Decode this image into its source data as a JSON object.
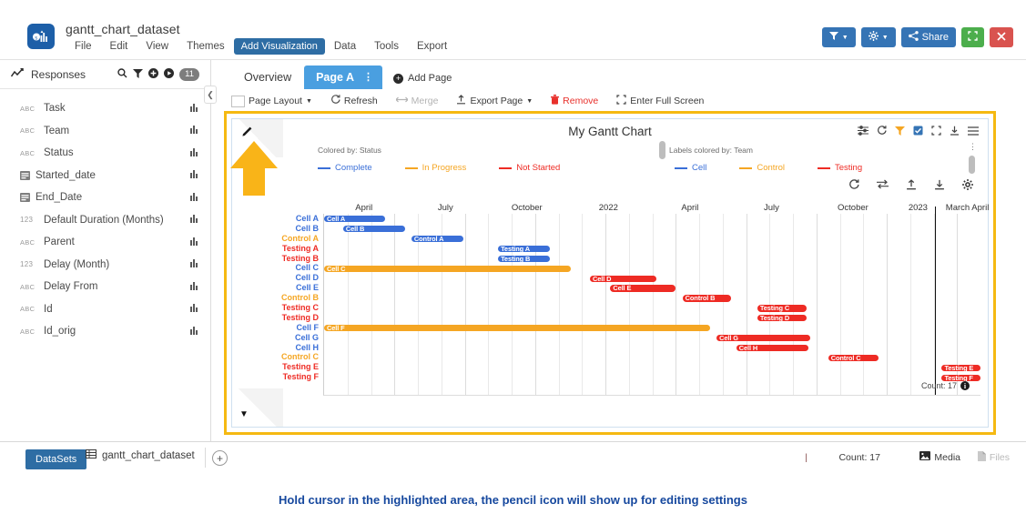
{
  "app": {
    "title": "gantt_chart_dataset",
    "logo_icon": "app-logo-icon",
    "menu": [
      "File",
      "Edit",
      "View",
      "Themes",
      "Add Visualization",
      "Data",
      "Tools",
      "Export"
    ],
    "active_menu": "Add Visualization"
  },
  "topright": {
    "filter_label": "",
    "filter_icon": "filter-icon",
    "settings_icon": "gear-icon",
    "share_label": "Share",
    "share_icon": "share-icon",
    "fullscreen_icon": "expand-icon",
    "close_icon": "close-icon",
    "colors": {
      "blue": "#3574b5",
      "green": "#4cae4c",
      "red": "#d9534f"
    }
  },
  "sidebar": {
    "header": {
      "label": "Responses",
      "icon": "chart-line-icon",
      "count": "11"
    },
    "header_icons": [
      "search-icon",
      "filter-icon",
      "add-circle-icon",
      "play-circle-icon"
    ],
    "fields": [
      {
        "type": "ABC",
        "name": "Task"
      },
      {
        "type": "ABC",
        "name": "Team"
      },
      {
        "type": "ABC",
        "name": "Status"
      },
      {
        "type": "DATE",
        "name": "Started_date"
      },
      {
        "type": "DATE",
        "name": "End_Date"
      },
      {
        "type": "123",
        "name": "Default Duration (Months)"
      },
      {
        "type": "ABC",
        "name": "Parent"
      },
      {
        "type": "123",
        "name": "Delay (Month)"
      },
      {
        "type": "ABC",
        "name": "Delay From"
      },
      {
        "type": "ABC",
        "name": "Id"
      },
      {
        "type": "ABC",
        "name": "Id_orig"
      }
    ],
    "collapse_icon": "chevron-left-icon"
  },
  "tabs": {
    "items": [
      {
        "label": "Overview",
        "active": false
      },
      {
        "label": "Page A",
        "active": true
      }
    ],
    "add_page_label": "Add Page"
  },
  "page_toolbar": [
    {
      "label": "Page Layout",
      "icon": "checkbox-icon",
      "caret": true,
      "state": "normal"
    },
    {
      "label": "Refresh",
      "icon": "refresh-icon",
      "caret": false,
      "state": "normal"
    },
    {
      "label": "Merge",
      "icon": "merge-icon",
      "caret": false,
      "state": "disabled"
    },
    {
      "label": "Export Page",
      "icon": "export-icon",
      "caret": true,
      "state": "normal"
    },
    {
      "label": "Remove",
      "icon": "trash-icon",
      "caret": false,
      "state": "danger"
    },
    {
      "label": "Enter Full Screen",
      "icon": "fullscreen-icon",
      "caret": false,
      "state": "normal"
    }
  ],
  "chart_panel": {
    "title": "My Gantt Chart",
    "pencil_icon": "pencil-icon",
    "bottom_caret_icon": "caret-down-icon",
    "header_icons": [
      "sliders-icon",
      "refresh-icon",
      "filter-icon",
      "checkbox-icon",
      "expand-icon",
      "download-icon",
      "menu-icon"
    ],
    "secondary_icons": [
      "refresh-icon",
      "swap-icon",
      "upload-icon",
      "download-icon",
      "gear-icon"
    ],
    "legend_left": {
      "label": "Colored by: Status",
      "menu_icon": "vertical-dots-icon",
      "items": [
        {
          "label": "Complete",
          "color": "#3a6fd8"
        },
        {
          "label": "In Progress",
          "color": "#f5a623"
        },
        {
          "label": "Not Started",
          "color": "#ee2b24"
        }
      ]
    },
    "legend_right": {
      "label": "Labels colored by: Team",
      "menu_icon": "vertical-dots-icon",
      "items": [
        {
          "label": "Cell",
          "color": "#3a6fd8"
        },
        {
          "label": "Control",
          "color": "#f5a623"
        },
        {
          "label": "Testing",
          "color": "#ee2b24"
        }
      ]
    },
    "count_label": "Count: 17",
    "info_icon": "info-icon"
  },
  "chart_data": {
    "type": "bar",
    "chart_subtype": "gantt",
    "title": "My Gantt Chart",
    "xlabel": "",
    "ylabel": "",
    "grid": true,
    "legend_position": "top",
    "axis_ticks": [
      {
        "label": "April",
        "pos": 6.2
      },
      {
        "label": "July",
        "pos": 18.6
      },
      {
        "label": "October",
        "pos": 31.0
      },
      {
        "label": "2022",
        "pos": 43.4
      },
      {
        "label": "April",
        "pos": 55.8
      },
      {
        "label": "July",
        "pos": 68.2
      },
      {
        "label": "October",
        "pos": 80.6
      },
      {
        "label": "2023",
        "pos": 90.5
      },
      {
        "label": "March April",
        "pos": 98.0
      }
    ],
    "today_marker_pos": 93.0,
    "axis_range_note": "Jan 2021 through April 2023 (monthly gridlines)",
    "categories": [
      "Cell A",
      "Cell B",
      "Control A",
      "Testing A",
      "Testing B",
      "Cell C",
      "Cell D",
      "Cell E",
      "Control B",
      "Testing C",
      "Testing D",
      "Cell F",
      "Cell G",
      "Cell H",
      "Control C",
      "Testing E",
      "Testing F"
    ],
    "tasks": [
      {
        "task": "Cell A",
        "team": "Cell",
        "status": "Complete",
        "label_color": "#3a6fd8",
        "bar_color": "#3a6fd8",
        "start": 0.0,
        "end": 9.3
      },
      {
        "task": "Cell B",
        "team": "Cell",
        "status": "Complete",
        "label_color": "#3a6fd8",
        "bar_color": "#3a6fd8",
        "start": 2.9,
        "end": 12.3
      },
      {
        "task": "Control A",
        "team": "Control",
        "status": "Complete",
        "label_color": "#f5a623",
        "bar_color": "#3a6fd8",
        "start": 13.3,
        "end": 21.2
      },
      {
        "task": "Testing A",
        "team": "Testing",
        "status": "Complete",
        "label_color": "#ee2b24",
        "bar_color": "#3a6fd8",
        "start": 26.5,
        "end": 34.4
      },
      {
        "task": "Testing B",
        "team": "Testing",
        "status": "Complete",
        "label_color": "#ee2b24",
        "bar_color": "#3a6fd8",
        "start": 26.5,
        "end": 34.4
      },
      {
        "task": "Cell C",
        "team": "Cell",
        "status": "In Progress",
        "label_color": "#3a6fd8",
        "bar_color": "#f5a623",
        "start": 0.0,
        "end": 37.6
      },
      {
        "task": "Cell D",
        "team": "Cell",
        "status": "Not Started",
        "label_color": "#3a6fd8",
        "bar_color": "#ee2b24",
        "start": 40.5,
        "end": 50.6
      },
      {
        "task": "Cell E",
        "team": "Cell",
        "status": "Not Started",
        "label_color": "#3a6fd8",
        "bar_color": "#ee2b24",
        "start": 43.6,
        "end": 53.5
      },
      {
        "task": "Control B",
        "team": "Control",
        "status": "Not Started",
        "label_color": "#f5a623",
        "bar_color": "#ee2b24",
        "start": 54.6,
        "end": 62.0
      },
      {
        "task": "Testing C",
        "team": "Testing",
        "status": "Not Started",
        "label_color": "#ee2b24",
        "bar_color": "#ee2b24",
        "start": 66.0,
        "end": 73.5
      },
      {
        "task": "Testing D",
        "team": "Testing",
        "status": "Not Started",
        "label_color": "#ee2b24",
        "bar_color": "#ee2b24",
        "start": 66.0,
        "end": 73.5
      },
      {
        "task": "Cell F",
        "team": "Cell",
        "status": "In Progress",
        "label_color": "#3a6fd8",
        "bar_color": "#f5a623",
        "start": 0.0,
        "end": 58.8
      },
      {
        "task": "Cell G",
        "team": "Cell",
        "status": "Not Started",
        "label_color": "#3a6fd8",
        "bar_color": "#ee2b24",
        "start": 59.8,
        "end": 74.0
      },
      {
        "task": "Cell H",
        "team": "Cell",
        "status": "Not Started",
        "label_color": "#3a6fd8",
        "bar_color": "#ee2b24",
        "start": 62.8,
        "end": 73.8
      },
      {
        "task": "Control C",
        "team": "Control",
        "status": "Not Started",
        "label_color": "#f5a623",
        "bar_color": "#ee2b24",
        "start": 76.8,
        "end": 84.4
      },
      {
        "task": "Testing E",
        "team": "Testing",
        "status": "Not Started",
        "label_color": "#ee2b24",
        "bar_color": "#ee2b24",
        "start": 94.1,
        "end": 100.0
      },
      {
        "task": "Testing F",
        "team": "Testing",
        "status": "Not Started",
        "label_color": "#ee2b24",
        "bar_color": "#ee2b24",
        "start": 94.1,
        "end": 100.0
      }
    ]
  },
  "bottom_bar": {
    "datasets_label": "DataSets",
    "dataset_name": "gantt_chart_dataset",
    "dataset_icon": "table-icon",
    "add_icon": "plus-icon",
    "pipe": "|",
    "count_label": "Count: 17",
    "media_label": "Media",
    "media_icon": "image-icon",
    "files_label": "Files",
    "files_icon": "file-icon"
  },
  "caption": "Hold cursor in the highlighted area, the pencil icon will show up for editing settings",
  "annotation": {
    "arrow_icon": "up-arrow-annotation",
    "arrow_color": "#f5b912",
    "highlight_color": "#f5b912"
  }
}
